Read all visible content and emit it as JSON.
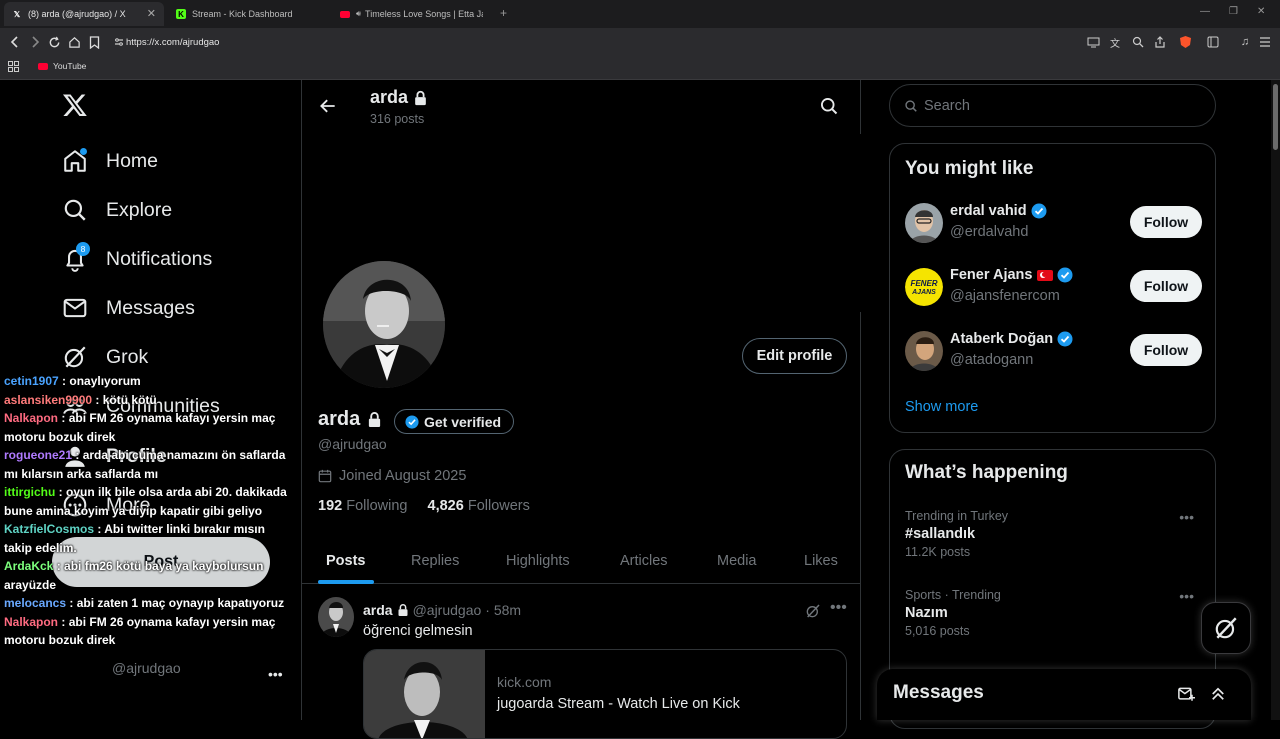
{
  "browser": {
    "tabs": [
      {
        "title": "(8) arda (@ajrudgao) / X",
        "active": true,
        "favicon": "x-logo"
      },
      {
        "title": "Stream - Kick Dashboard",
        "active": false,
        "favicon": "kick-logo"
      },
      {
        "title": "Timeless Love Songs | Etta James",
        "active": false,
        "favicon": "youtube-logo"
      }
    ],
    "url": "https://x.com/ajrudgao",
    "bookmarks": [
      {
        "label": "YouTube",
        "icon": "youtube-icon"
      }
    ]
  },
  "nav": {
    "items": [
      {
        "label": "Home",
        "icon": "home-icon"
      },
      {
        "label": "Explore",
        "icon": "search-icon"
      },
      {
        "label": "Notifications",
        "icon": "bell-icon",
        "badge": "8"
      },
      {
        "label": "Messages",
        "icon": "mail-icon"
      },
      {
        "label": "Grok",
        "icon": "grok-icon"
      },
      {
        "label": "Communities",
        "icon": "communities-icon"
      },
      {
        "label": "Profile",
        "icon": "person-icon"
      },
      {
        "label": "More",
        "icon": "more-circle-icon"
      }
    ],
    "post_label": "Post",
    "account_handle": "@ajrudgao"
  },
  "chat": [
    {
      "user": "cetin1907",
      "color": "#4aa3ff",
      "text": "onaylıyorum"
    },
    {
      "user": "aslansiken9900",
      "color": "#ff7b7b",
      "text": "kötü kötü"
    },
    {
      "user": "Nalkapon",
      "color": "#ff6b81",
      "text": "abi FM 26 oynama kafayı yersin maç motoru bozuk direk"
    },
    {
      "user": "rogueone21",
      "color": "#b07bff",
      "text": "arda abi cuma namazını ön saflarda mı kılarsın arka saflarda mı"
    },
    {
      "user": "ittirgichu",
      "color": "#53fc18",
      "text": "oyun ilk bile olsa arda abi 20. dakikada bune amina koyim ya diyip kapatir gibi geliyo"
    },
    {
      "user": "KatzfielCosmos",
      "color": "#5fd3c4",
      "text": "Abi twitter linki bırakır mısın takip edelim."
    },
    {
      "user": "ArdaKck",
      "color": "#7dff7d",
      "text": "abi fm26 kötü baya ya kaybolursun arayüzde"
    },
    {
      "user": "melocancs",
      "color": "#6aa9ff",
      "text": "abi zaten 1 maç oynayıp kapatıyoruz"
    },
    {
      "user": "Nalkapon",
      "color": "#ff6b81",
      "text": "abi FM 26 oynama kafayı yersin maç motoru bozuk direk"
    }
  ],
  "profile": {
    "header_name": "arda",
    "posts_count": "316 posts",
    "name": "arda",
    "get_verified": "Get verified",
    "handle": "@ajrudgao",
    "joined": "Joined August 2025",
    "following_count": "192",
    "following_label": "Following",
    "followers_count": "4,826",
    "followers_label": "Followers",
    "edit_profile": "Edit profile",
    "tabs": [
      "Posts",
      "Replies",
      "Highlights",
      "Articles",
      "Media",
      "Likes"
    ],
    "active_tab": "Posts"
  },
  "post": {
    "name": "arda",
    "handle": "@ajrudgao",
    "time": "· 58m",
    "text": "öğrenci gelmesin",
    "card_domain": "kick.com",
    "card_title": "jugoarda Stream - Watch Live on Kick"
  },
  "right": {
    "search_placeholder": "Search",
    "suggestions_title": "You might like",
    "suggestions": [
      {
        "name": "erdal vahid",
        "handle": "@erdalvahd",
        "verified": true,
        "flag": "",
        "follow": "Follow"
      },
      {
        "name": "Fener Ajans",
        "handle": "@ajansfenercom",
        "verified": true,
        "flag": "turkey-flag",
        "follow": "Follow"
      },
      {
        "name": "Ataberk Doğan",
        "handle": "@atadogann",
        "verified": true,
        "flag": "",
        "follow": "Follow"
      }
    ],
    "show_more": "Show more",
    "happening_title": "What’s happening",
    "trends": [
      {
        "meta": "Trending in Turkey",
        "name": "#sallandık",
        "count": "11.2K posts"
      },
      {
        "meta": "Sports · Trending",
        "name": "Nazım",
        "count": "5,016 posts"
      }
    ],
    "messages_title": "Messages"
  },
  "colors": {
    "accent": "#1d9bf0",
    "background": "#000000",
    "border": "#2f3336",
    "muted": "#71767b"
  }
}
